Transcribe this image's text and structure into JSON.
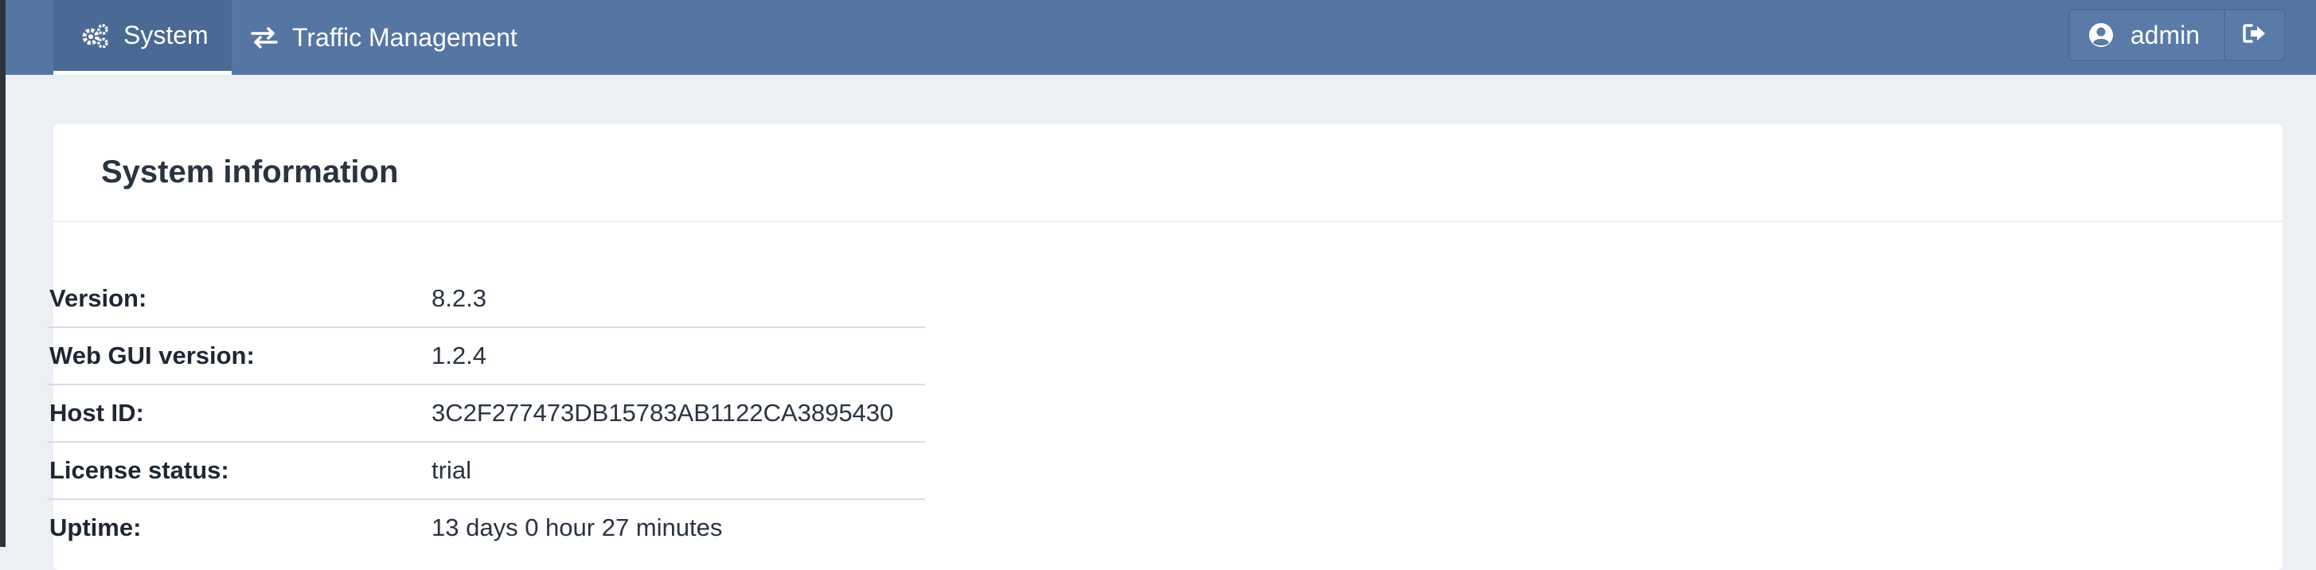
{
  "navbar": {
    "tabs": [
      {
        "label": "System",
        "icon": "gears-icon",
        "active": true
      },
      {
        "label": "Traffic Management",
        "icon": "exchange-icon",
        "active": false
      }
    ],
    "user": {
      "name": "admin",
      "icon": "user-circle-icon"
    },
    "logout_icon": "sign-out-icon"
  },
  "card": {
    "title": "System information",
    "rows": [
      {
        "label": "Version:",
        "value": "8.2.3"
      },
      {
        "label": "Web GUI version:",
        "value": "1.2.4"
      },
      {
        "label": "Host ID:",
        "value": "3C2F277473DB15783AB1122CA3895430"
      },
      {
        "label": "License status:",
        "value": "trial"
      },
      {
        "label": "Uptime:",
        "value": "13 days 0 hour 27 minutes"
      }
    ]
  },
  "colors": {
    "navbar": "#5576a3",
    "navbar_active": "#4a6994",
    "page_bg": "#eceff3",
    "card_bg": "#ffffff"
  }
}
